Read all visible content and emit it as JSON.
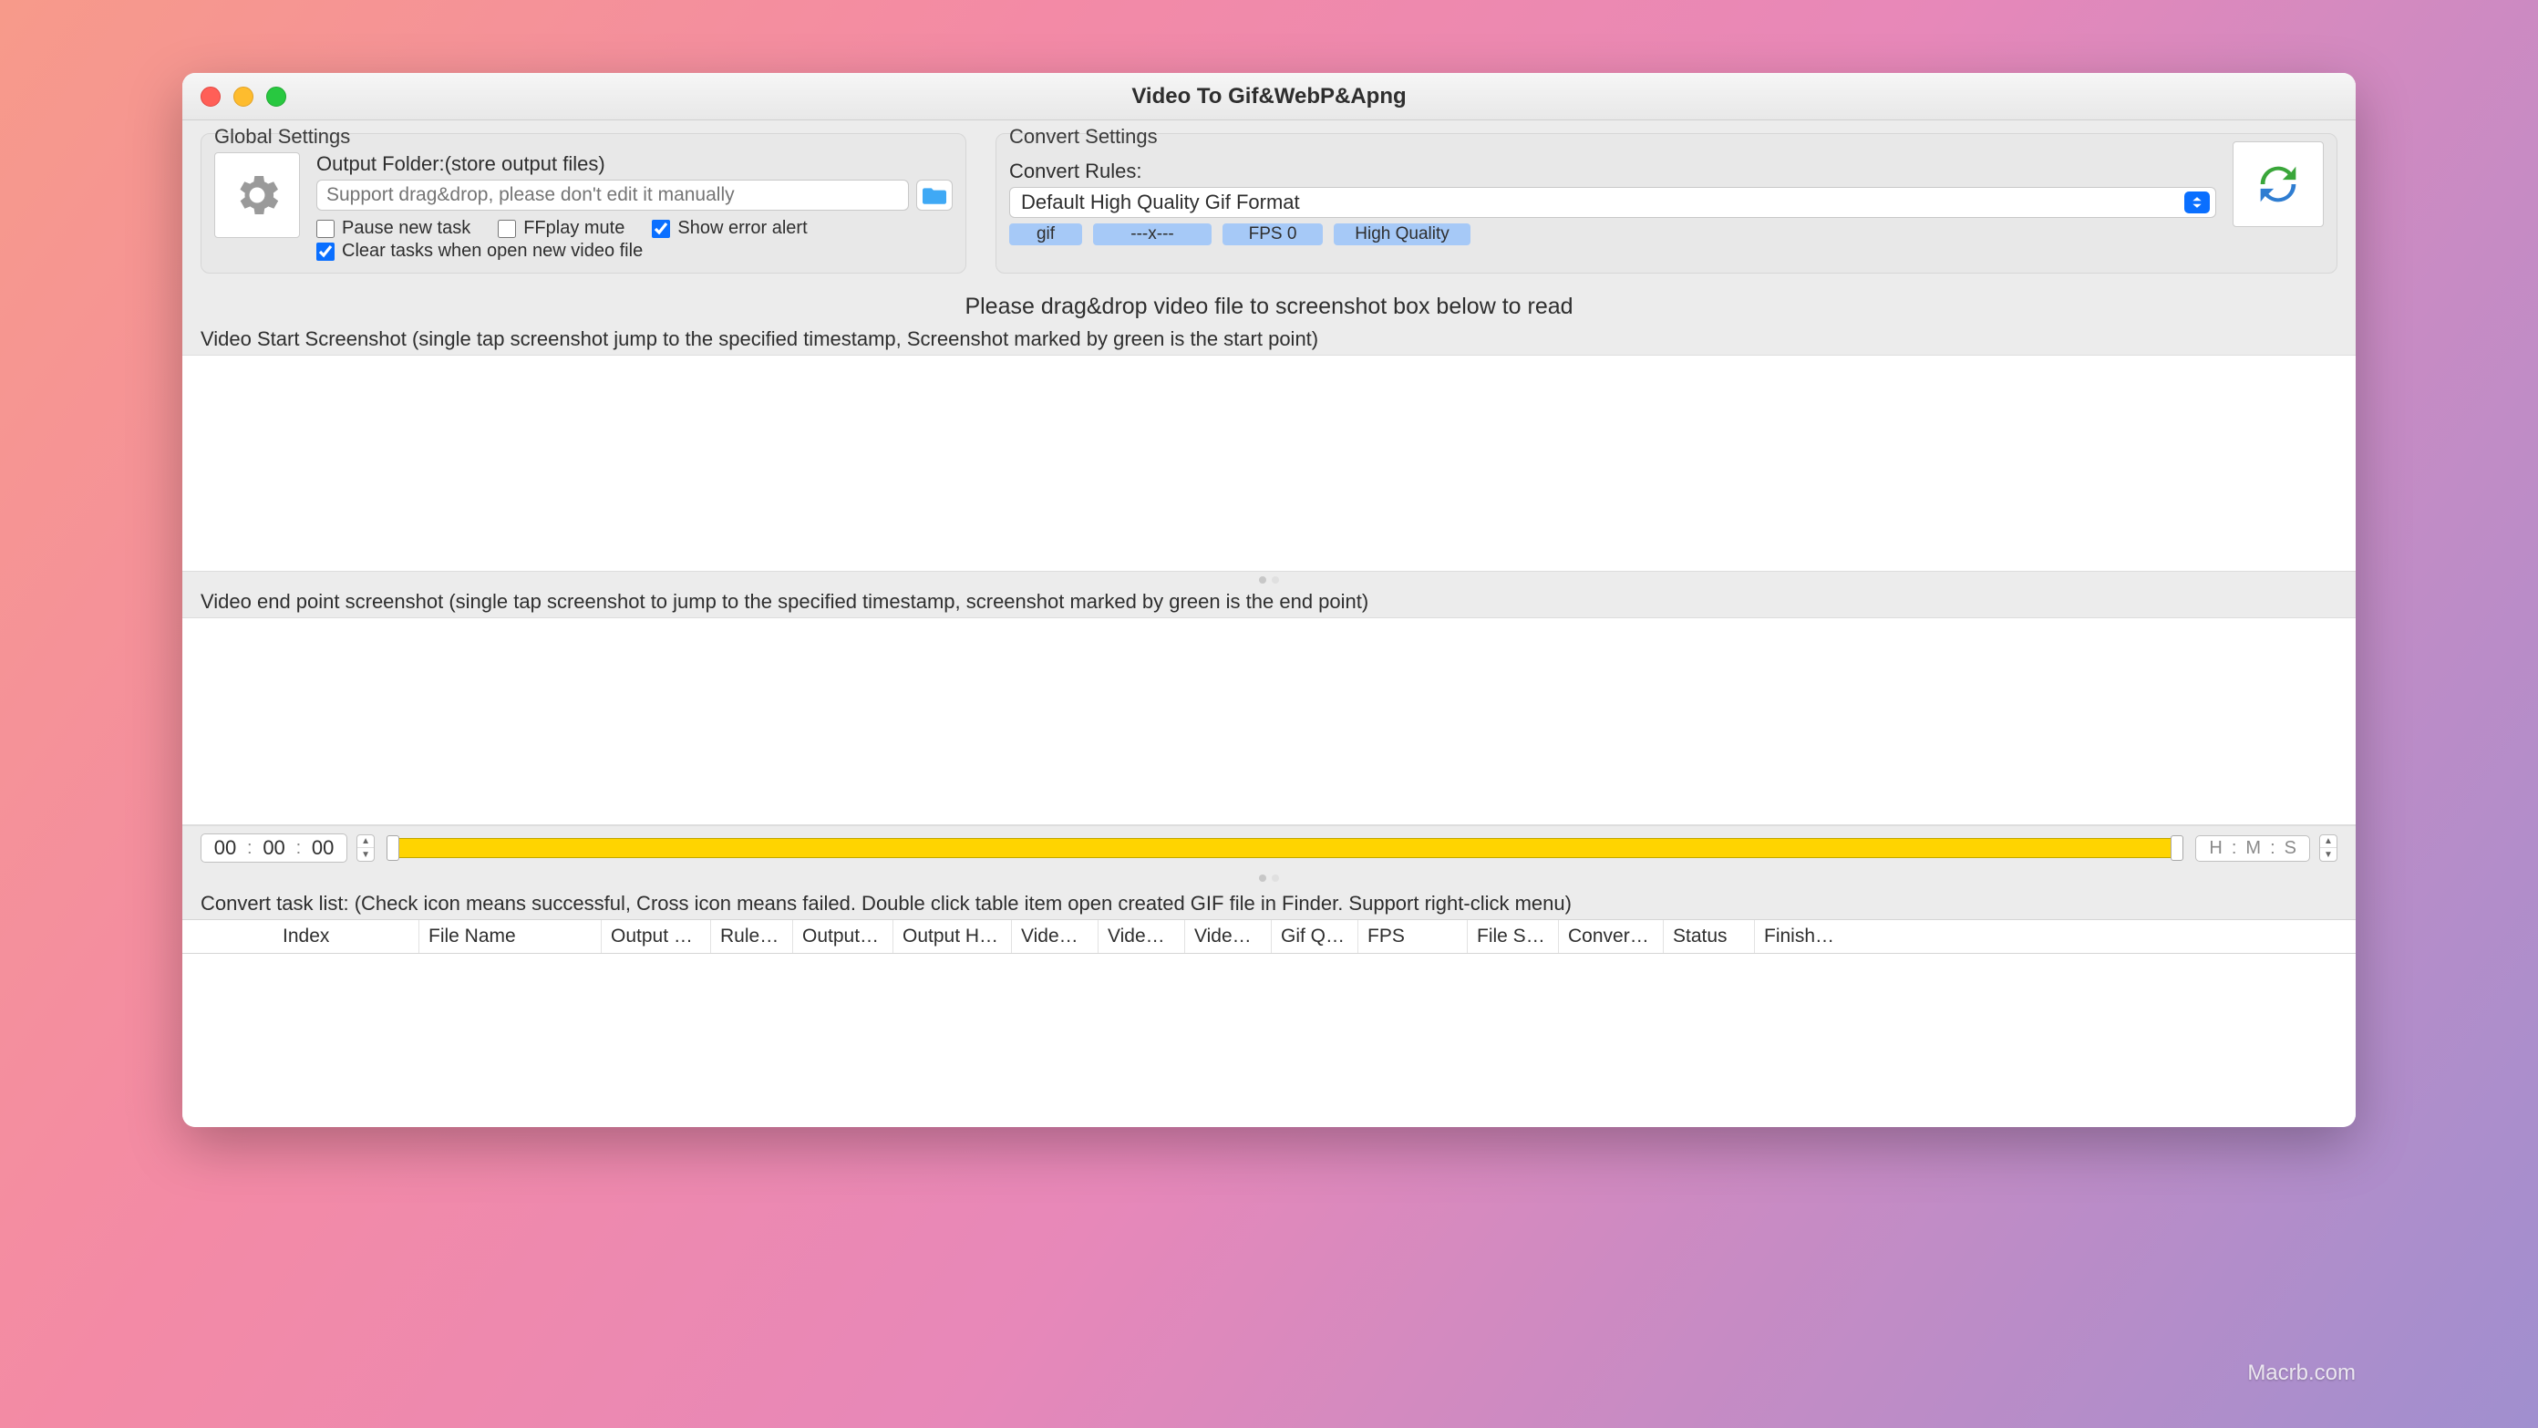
{
  "window": {
    "title": "Video To Gif&WebP&Apng"
  },
  "global": {
    "title": "Global Settings",
    "output_folder_label": "Output Folder:(store output files)",
    "output_folder_placeholder": "Support drag&drop, please don't edit it manually",
    "pause_new_task": {
      "label": "Pause new task",
      "checked": false
    },
    "ffplay_mute": {
      "label": "FFplay mute",
      "checked": false
    },
    "show_error_alert": {
      "label": "Show error alert",
      "checked": true
    },
    "clear_tasks": {
      "label": "Clear tasks when open new video file",
      "checked": true
    }
  },
  "convert": {
    "title": "Convert Settings",
    "rules_label": "Convert Rules:",
    "selected_rule": "Default High Quality Gif Format",
    "pills": {
      "format": "gif",
      "size": "---x---",
      "fps": "FPS 0",
      "quality": "High Quality"
    }
  },
  "drop_prompt": "Please drag&drop video file to screenshot box below to read",
  "start_label": "Video Start Screenshot (single tap screenshot jump to the specified timestamp, Screenshot marked by green is the start point)",
  "end_label": "Video end point screenshot (single tap screenshot to jump to the specified timestamp, screenshot marked by green is the end point)",
  "time": {
    "h": "00",
    "m": "00",
    "s": "00",
    "hint": {
      "h": "H",
      "m": "M",
      "s": "S"
    }
  },
  "tasklist": {
    "label": "Convert task list: (Check icon means successful, Cross icon means failed. Double click table item open created GIF file in Finder. Support right-click menu)",
    "columns": [
      "",
      "Index",
      "File Name",
      "Output F…",
      "Rule…",
      "Output…",
      "Output Hei…",
      "Video…",
      "Video…",
      "Video…",
      "Gif Q…",
      "FPS",
      "File Si…",
      "Convert…",
      "Status",
      "Finish…"
    ]
  },
  "watermark": "Macrb.com"
}
